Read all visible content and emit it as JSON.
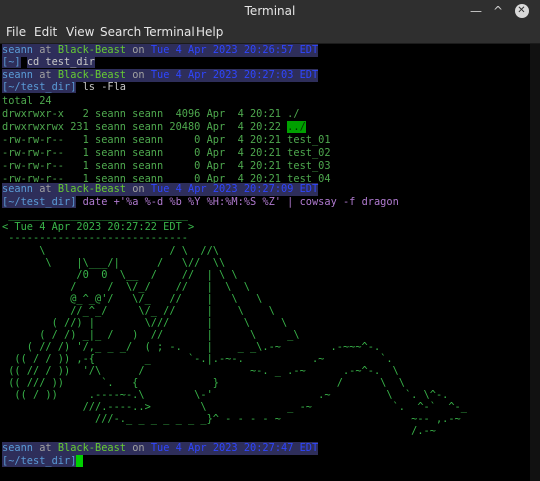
{
  "window": {
    "title": "Terminal",
    "min_icon": "minimize-icon",
    "max_icon": "maximize-icon",
    "close_icon": "close-icon",
    "min_glyph": "—",
    "max_glyph": "^",
    "close_glyph": "✕"
  },
  "menu": {
    "items": [
      "File",
      "Edit",
      "View",
      "Search",
      "Terminal",
      "Help"
    ]
  },
  "prompt": {
    "user": "seann",
    "host": "Black-Beast",
    "on": "at",
    "dates": [
      "Tue 4 Apr 2023 20:26:57 EDT",
      "Tue 4 Apr 2023 20:27:03 EDT",
      "Tue 4 Apr 2023 20:27:09 EDT",
      "Tue 4 Apr 2023 20:27:47 EDT"
    ],
    "dirs": [
      "[~]",
      "[~/test_dir]",
      "[~/test_dir]",
      "[~/test_dir]"
    ]
  },
  "commands": {
    "cmd1": "cd test_dir",
    "cmd2": "ls -Fla",
    "cmd3": "date +'%a %-d %b %Y %H:%M:%S %Z' | cowsay -f dragon"
  },
  "ls": {
    "total": "total 24",
    "rows": [
      "drwxrwxr-x   2 seann seann  4096 Apr  4 20:21 ./",
      "drwxrwxrwx 231 seann seann 20480 Apr  4 20:22 ",
      "-rw-rw-r--   1 seann seann     0 Apr  4 20:21 test_01",
      "-rw-rw-r--   1 seann seann     0 Apr  4 20:21 test_02",
      "-rw-rw-r--   1 seann seann     0 Apr  4 20:21 test_03",
      "-rw-rw-r--   1 seann seann     0 Apr  4 20:21 test_04"
    ],
    "parent_dir": "../"
  },
  "cowsay": {
    "top": " _____________________________",
    "text": "< Tue 4 Apr 2023 20:27:22 EDT >",
    "bottom": " -----------------------------",
    "art": [
      "      \\                    / \\  //\\",
      "       \\    |\\___/|      /   \\//  \\\\",
      "            /0  0  \\__  /    //  | \\ \\",
      "           /     /  \\/_/    //   |  \\  \\",
      "           @_^_@'/   \\/_   //    |   \\   \\",
      "           //_^_/     \\/_ //     |    \\    \\",
      "        ( //) |        \\///      |     \\     \\",
      "      ( / /) _|_ /   )  //       |      \\     _\\",
      "    ( // /) '/,_ _ _/  ( ; -.    |    _ _\\.-~        .-~~~^-.",
      "  (( / / )) ,-{        _      `-.|.-~-.           .~         `.",
      " (( // / ))  '/\\      /                 ~-. _ .-~      .-~^-.  \\",
      " (( /// ))      `.   {            }                   /      \\  \\",
      "  (( / ))     .----~-.\\        \\-'                 .~         \\  `. \\^-.",
      "             ///.----..>        \\             _ -~             `.  ^-`  ^-_",
      "               ///-._ _ _ _ _ _ _}^ - - - - ~                     ~-- ,.-~",
      "                                                                  /.-~"
    ]
  }
}
